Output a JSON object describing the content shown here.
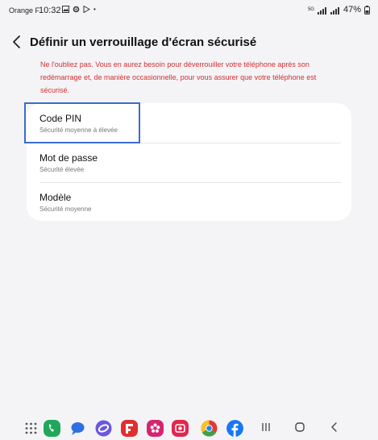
{
  "status_bar": {
    "carrier": "Orange F",
    "time": "10:32",
    "network": "5G",
    "battery": "47%"
  },
  "header": {
    "title": "Définir un verrouillage d'écran sécurisé"
  },
  "warning_text": "Ne l'oubliez pas. Vous en aurez besoin pour déverrouiller votre téléphone après son redémarrage et, de manière occasionnelle, pour vous assurer que votre téléphone est sécurisé.",
  "options": [
    {
      "label": "Code PIN",
      "sub": "Sécurité moyenne à élevée"
    },
    {
      "label": "Mot de passe",
      "sub": "Sécurité élevée"
    },
    {
      "label": "Modèle",
      "sub": "Sécurité moyenne"
    }
  ],
  "colors": {
    "warning": "#d32f2f",
    "highlight": "#3b6ccc",
    "background": "#f4f4f7"
  },
  "taskbar": {
    "apps": [
      "app-drawer-icon",
      "phone-icon",
      "messages-icon",
      "internet-icon",
      "flipboard-icon",
      "blossom-icon",
      "camera-icon",
      "chrome-icon",
      "facebook-icon"
    ],
    "nav": [
      "recents-button",
      "home-button",
      "back-button"
    ]
  }
}
